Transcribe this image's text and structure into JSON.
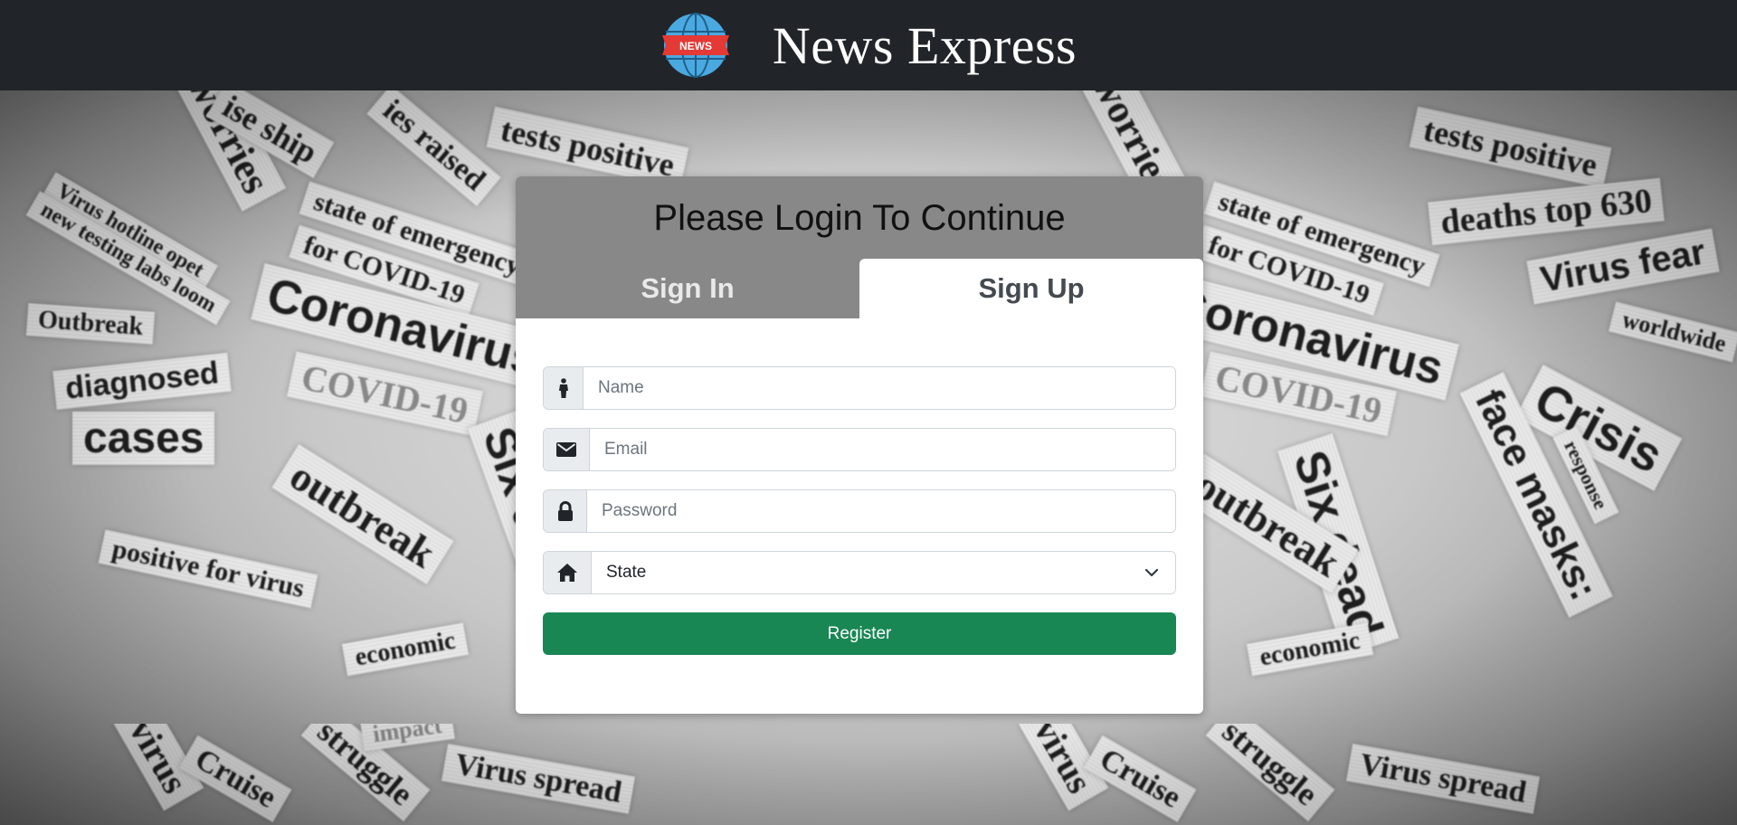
{
  "header": {
    "brand_name": "News Express",
    "logo_text": "NEWS"
  },
  "background": {
    "headlines": [
      "worries",
      "ise ship",
      "ies raised",
      "tests positive",
      "state of emergency",
      "for COVID-19",
      "Virus hotline opet",
      "new testing labs loom",
      "Coronavirus",
      "Outbreak",
      "diagnosed",
      "COVID-19",
      "cases",
      "outbreak",
      "positive for virus",
      "economic",
      "Six dead",
      "deaths top 630",
      "Virus fear",
      "worldwide",
      "Crisis",
      "face masks:",
      "response",
      "virus",
      "Cruise",
      "struggle",
      "Virus spread",
      "impact"
    ]
  },
  "card": {
    "title": "Please Login To Continue",
    "tabs": [
      {
        "label": "Sign In",
        "active": false
      },
      {
        "label": "Sign Up",
        "active": true
      }
    ],
    "fields": {
      "name": {
        "placeholder": "Name",
        "icon": "person-icon"
      },
      "email": {
        "placeholder": "Email",
        "icon": "envelope-icon"
      },
      "password": {
        "placeholder": "Password",
        "icon": "lock-icon"
      },
      "state": {
        "selected": "State",
        "icon": "home-icon"
      }
    },
    "register_label": "Register"
  },
  "colors": {
    "header_bg": "#212529",
    "card_header_bg": "#888888",
    "register_bg": "#198754"
  }
}
